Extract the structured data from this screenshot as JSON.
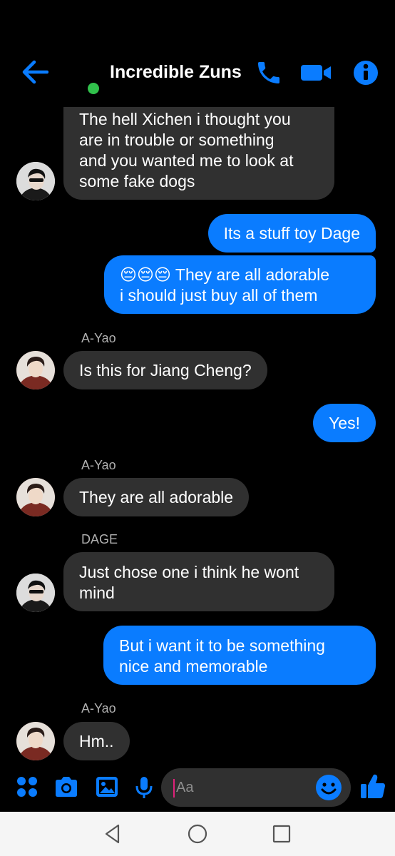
{
  "header": {
    "title": "Incredible Zuns",
    "online": true,
    "icons": [
      "back-arrow-icon",
      "phone-icon",
      "video-camera-icon",
      "info-icon"
    ]
  },
  "messages": [
    {
      "direction": "in",
      "lines": [
        "The hell Xichen i thought you",
        "are in trouble or something",
        "and you wanted me to look at",
        "some fake dogs"
      ]
    },
    {
      "direction": "out",
      "lines": [
        "Its a stuff toy Dage"
      ]
    },
    {
      "direction": "out",
      "lines": [
        "😔😔😔 They are all adorable",
        "i should just buy all of them"
      ]
    },
    {
      "direction": "in",
      "sender": "A-Yao",
      "lines": [
        "Is this for Jiang Cheng?"
      ]
    },
    {
      "direction": "out",
      "lines": [
        "Yes!"
      ]
    },
    {
      "direction": "in",
      "sender": "A-Yao",
      "lines": [
        "They are all adorable"
      ]
    },
    {
      "direction": "in",
      "sender": "DAGE",
      "lines": [
        "Just chose one i think he wont",
        "mind"
      ]
    },
    {
      "direction": "out",
      "lines": [
        "But i want it to be something",
        "nice and memorable"
      ]
    },
    {
      "direction": "in",
      "sender": "A-Yao",
      "lines": [
        "Hm.."
      ]
    }
  ],
  "composer": {
    "placeholder": "Aa",
    "icons": [
      "apps-grid-icon",
      "camera-icon",
      "gallery-icon",
      "microphone-icon",
      "emoji-icon",
      "thumbs-up-icon"
    ]
  },
  "colors": {
    "background": "#000000",
    "accent": "#0a7cff",
    "incoming_bubble": "#303030",
    "online_dot": "#31c14c"
  }
}
